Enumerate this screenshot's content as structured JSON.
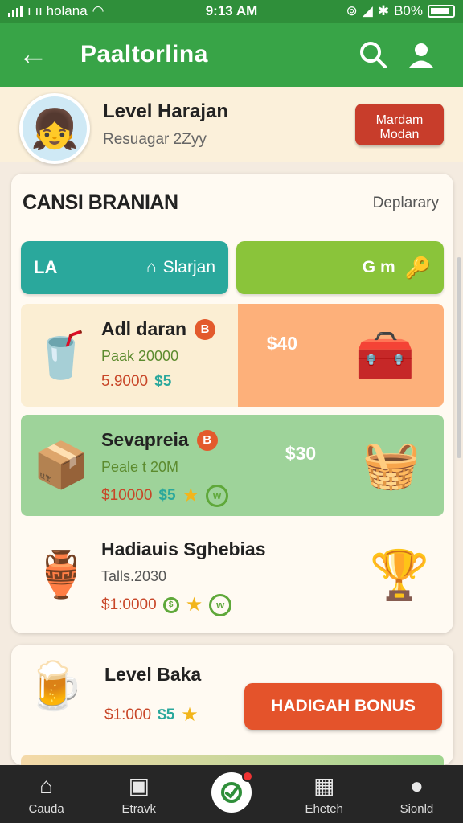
{
  "status": {
    "carrier": "ı ıı holana",
    "time": "9:13 AM",
    "battery": "B0%"
  },
  "appbar": {
    "title": "Paaltorlina"
  },
  "profile": {
    "name": "Level Harajan",
    "sub": "Resuagar 2Zyy",
    "button_line1": "Mardam",
    "button_line2": "Modan"
  },
  "section": {
    "title": "CANSI BRANIAN",
    "link": "Deplarary"
  },
  "tabs": {
    "left_icon_label": "LA",
    "left_label": "Slarjan",
    "right_label": "G m"
  },
  "rows": [
    {
      "name": "Adl daran",
      "badge": "B",
      "sub": "Paak 20000",
      "price": "5.9000",
      "price_suffix": "$5",
      "money": "$40",
      "icon": "cup-icon",
      "right_icon": "treasure-chest-icon"
    },
    {
      "name": "Sevapreia",
      "badge": "B",
      "sub": "Peale t 20M",
      "price": "$10000",
      "price_suffix": "$5",
      "money": "$30",
      "icon": "crate-icon",
      "right_icon": "fruit-basket-icon"
    },
    {
      "name": "Hadiauis Sghebias",
      "badge": "",
      "sub": "Talls.2030",
      "price": "$1:0000",
      "price_suffix": "",
      "money": "",
      "icon": "jar-icon",
      "right_icon": "trophy-icon"
    }
  ],
  "bonus": {
    "name": "Level Baka",
    "price": "$1:000",
    "price_suffix": "$5",
    "button": "HADIGAH BONUS"
  },
  "nav": [
    {
      "label": "Cauda"
    },
    {
      "label": "Etravk"
    },
    {
      "label": ""
    },
    {
      "label": "Eheteh"
    },
    {
      "label": "Sionld"
    }
  ],
  "colors": {
    "primary": "#38a447",
    "accent": "#e4532b",
    "teal": "#2aa89c",
    "lime": "#8ac43a"
  }
}
